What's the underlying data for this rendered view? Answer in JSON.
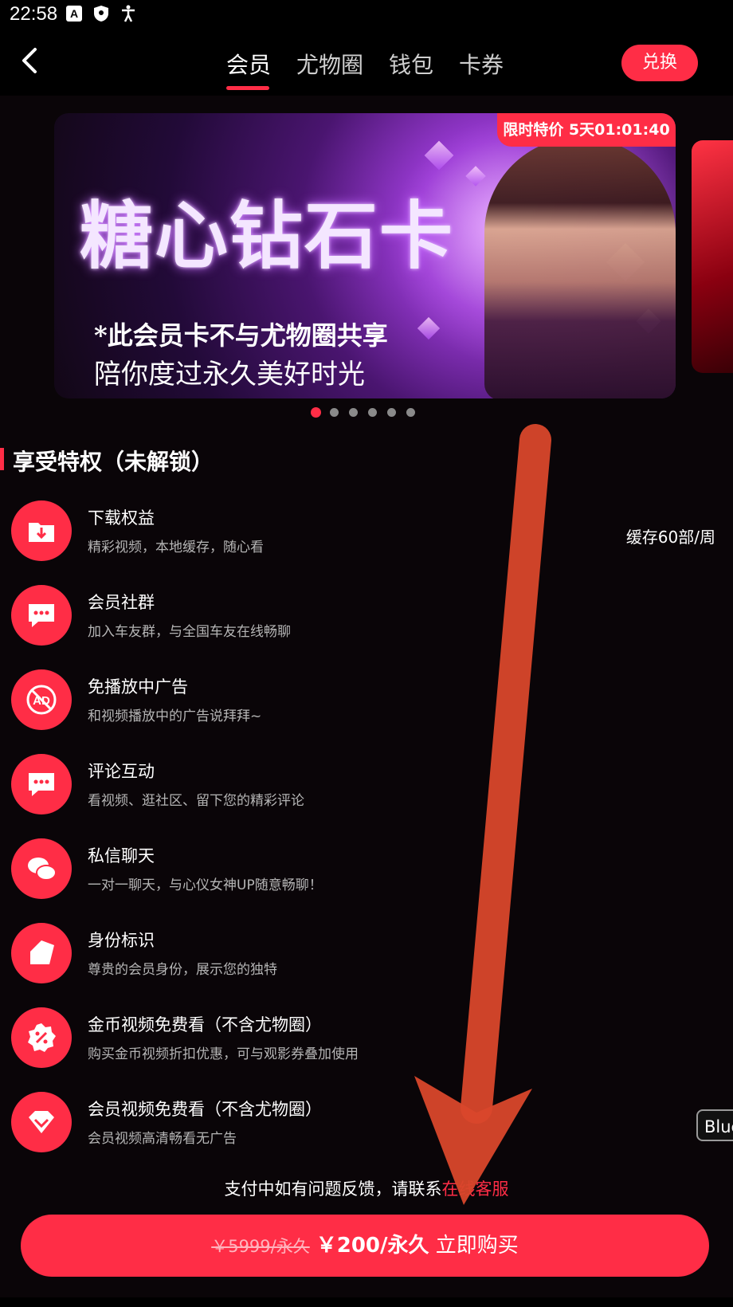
{
  "status_bar": {
    "time": "22:58"
  },
  "header": {
    "tabs": [
      {
        "label": "会员",
        "active": true
      },
      {
        "label": "尤物圈",
        "active": false
      },
      {
        "label": "钱包",
        "active": false
      },
      {
        "label": "卡券",
        "active": false
      }
    ],
    "exchange_label": "兑换"
  },
  "banner": {
    "badge": "限时特价 5天01:01:40",
    "title": "糖心钻石卡",
    "line1": "*此会员卡不与尤物圈共享",
    "line2": "陪你度过永久美好时光",
    "dots_count": 6,
    "active_dot": 0
  },
  "section": {
    "title": "享受特权（未解锁）"
  },
  "privileges": [
    {
      "name": "下载权益",
      "desc": "精彩视频，本地缓存，随心看",
      "extra": "缓存60部/周",
      "icon": "download-folder-icon"
    },
    {
      "name": "会员社群",
      "desc": "加入车友群，与全国车友在线畅聊",
      "extra": "",
      "icon": "chat-bubble-icon"
    },
    {
      "name": "免播放中广告",
      "desc": "和视频播放中的广告说拜拜~",
      "extra": "",
      "icon": "no-ads-icon"
    },
    {
      "name": "评论互动",
      "desc": "看视频、逛社区、留下您的精彩评论",
      "extra": "",
      "icon": "comment-icon"
    },
    {
      "name": "私信聊天",
      "desc": "一对一聊天，与心仪女神UP随意畅聊！",
      "extra": "",
      "icon": "messages-icon"
    },
    {
      "name": "身份标识",
      "desc": "尊贵的会员身份，展示您的独特",
      "extra": "",
      "icon": "tag-icon"
    },
    {
      "name": "金币视频免费看（不含尤物圈）",
      "desc": "购买金币视频折扣优惠，可与观影券叠加使用",
      "extra": "",
      "icon": "discount-badge-icon"
    },
    {
      "name": "会员视频免费看（不含尤物圈）",
      "desc": "会员视频高清畅看无广告",
      "extra": "",
      "icon": "diamond-icon"
    }
  ],
  "side_tag": "Blue",
  "support": {
    "text": "支付中如有问题反馈，请联系",
    "link": "在线客服"
  },
  "buy": {
    "old_price": "￥5999/永久",
    "price": "￥200/永久",
    "action": "立即购买"
  },
  "colors": {
    "accent": "#ff2d46",
    "background": "#0a0508",
    "arrow": "#d9472b"
  }
}
